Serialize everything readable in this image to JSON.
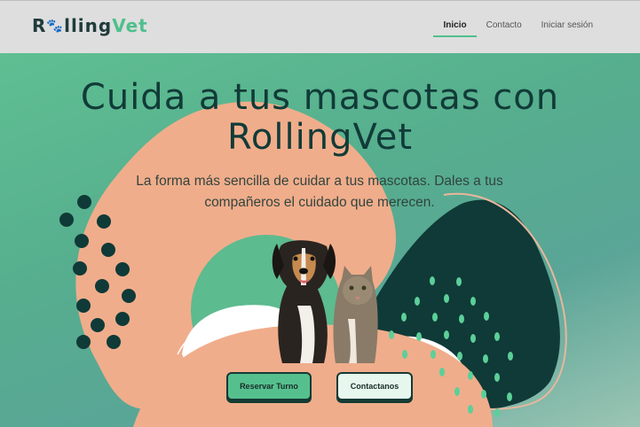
{
  "brand": {
    "logo_part1": "R",
    "logo_part2": "lling",
    "logo_part3": "Vet",
    "paw_icon": "paw-icon"
  },
  "nav": {
    "items": [
      {
        "label": "Inicio",
        "active": true
      },
      {
        "label": "Contacto",
        "active": false
      },
      {
        "label": "Iniciar sesión",
        "active": false
      }
    ]
  },
  "hero": {
    "title_line1": "Cuida a tus mascotas con",
    "title_line2": "RollingVet",
    "subtitle": "La forma más sencilla de cuidar a tus mascotas. Dales a tus compañeros el cuidado que merecen.",
    "image_alt": "dog and cat illustration"
  },
  "buttons": {
    "primary": "Reservar Turno",
    "secondary": "Contactanos"
  },
  "colors": {
    "accent": "#4fbf8c",
    "dark": "#113b38",
    "peach": "#f0ad8b",
    "nav_bg": "#dedede"
  }
}
